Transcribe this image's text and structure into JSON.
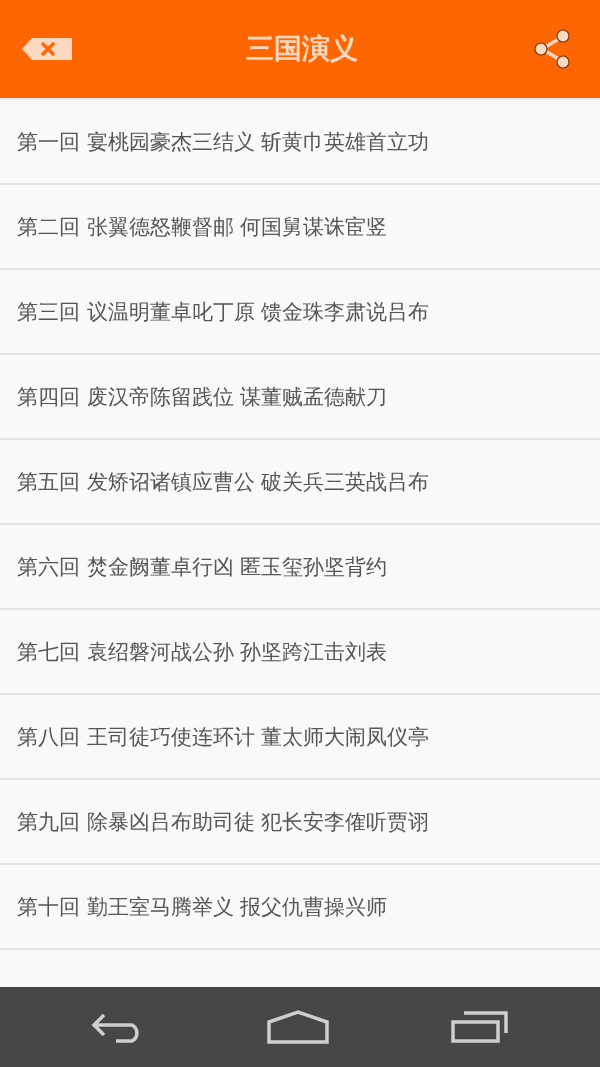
{
  "header": {
    "title": "三国演义"
  },
  "chapters": [
    {
      "title": "第一回 宴桃园豪杰三结义 斩黄巾英雄首立功"
    },
    {
      "title": "第二回 张翼德怒鞭督邮 何国舅谋诛宦竖"
    },
    {
      "title": "第三回 议温明董卓叱丁原 馈金珠李肃说吕布"
    },
    {
      "title": "第四回 废汉帝陈留践位 谋董贼孟德献刀"
    },
    {
      "title": "第五回 发矫诏诸镇应曹公 破关兵三英战吕布"
    },
    {
      "title": "第六回 焚金阙董卓行凶 匿玉玺孙坚背约"
    },
    {
      "title": "第七回 袁绍磐河战公孙 孙坚跨江击刘表"
    },
    {
      "title": "第八回 王司徒巧使连环计 董太师大闹凤仪亭"
    },
    {
      "title": "第九回 除暴凶吕布助司徒 犯长安李傕听贾诩"
    },
    {
      "title": "第十回 勤王室马腾举义 报父仇曹操兴师"
    }
  ]
}
